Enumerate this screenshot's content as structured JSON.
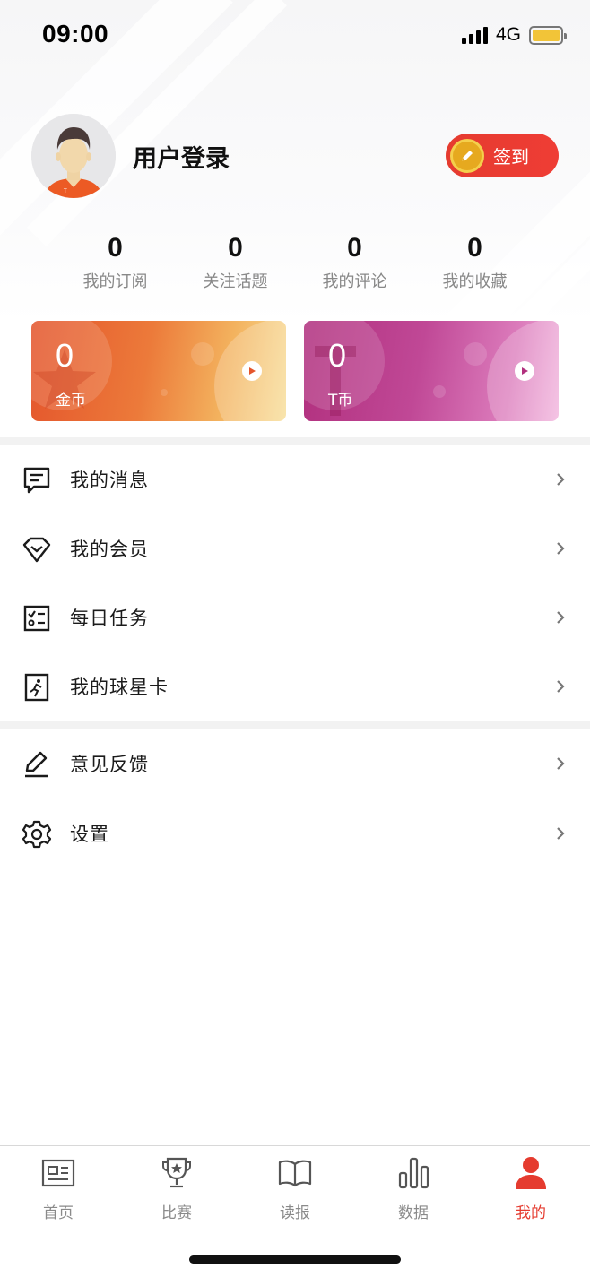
{
  "status_bar": {
    "time": "09:00",
    "network": "4G"
  },
  "profile": {
    "login_label": "用户登录",
    "checkin_label": "签到"
  },
  "stats": [
    {
      "value": "0",
      "label": "我的订阅"
    },
    {
      "value": "0",
      "label": "关注话题"
    },
    {
      "value": "0",
      "label": "我的评论"
    },
    {
      "value": "0",
      "label": "我的收藏"
    }
  ],
  "wallet": {
    "coin": {
      "value": "0",
      "label": "金币",
      "color": "#e4552c"
    },
    "tcoin": {
      "value": "0",
      "label": "T币",
      "color": "#b1307e"
    }
  },
  "menu": [
    {
      "label": "我的消息",
      "icon": "message-icon"
    },
    {
      "label": "我的会员",
      "icon": "diamond-icon"
    },
    {
      "label": "每日任务",
      "icon": "task-list-icon"
    },
    {
      "label": "我的球星卡",
      "icon": "player-card-icon"
    }
  ],
  "menu2": [
    {
      "label": "意见反馈",
      "icon": "edit-pen-icon"
    },
    {
      "label": "设置",
      "icon": "gear-icon"
    }
  ],
  "tabbar": {
    "active": "我的",
    "accent": "#e53b2f",
    "items": [
      {
        "label": "首页",
        "icon": "news-icon"
      },
      {
        "label": "比赛",
        "icon": "trophy-icon"
      },
      {
        "label": "读报",
        "icon": "book-icon"
      },
      {
        "label": "数据",
        "icon": "bar-chart-icon"
      },
      {
        "label": "我的",
        "icon": "person-icon"
      }
    ]
  }
}
